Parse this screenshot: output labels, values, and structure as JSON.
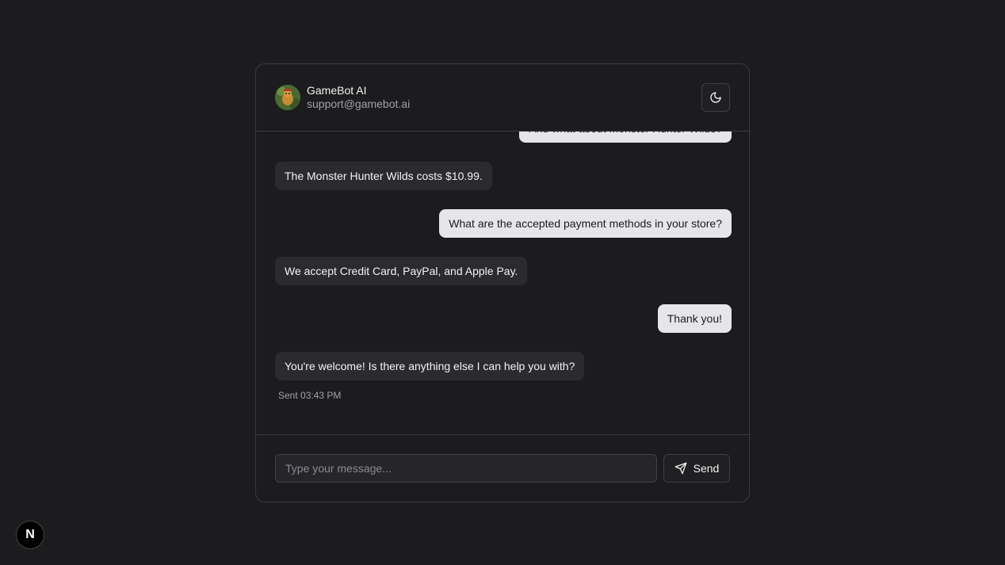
{
  "header": {
    "name": "GameBot AI",
    "email": "support@gamebot.ai"
  },
  "icons": {
    "theme": "moon-icon",
    "send": "send-icon",
    "avatar": "gamebot-avatar",
    "badge": "nextjs-logo-icon"
  },
  "messages": [
    {
      "role": "user",
      "text": "And what about Monster Hunter Wilds?"
    },
    {
      "role": "bot",
      "text": "The Monster Hunter Wilds costs $10.99."
    },
    {
      "role": "user",
      "text": "What are the accepted payment methods in your store?"
    },
    {
      "role": "bot",
      "text": "We accept Credit Card, PayPal, and Apple Pay."
    },
    {
      "role": "user",
      "text": "Thank you!"
    },
    {
      "role": "bot",
      "text": "You're welcome! Is there anything else I can help you with?"
    }
  ],
  "sent_label": "Sent 03:43 PM",
  "composer": {
    "placeholder": "Type your message...",
    "value": "",
    "send_label": "Send"
  },
  "badge_letter": "N",
  "colors": {
    "background": "#1c1c1e",
    "bot_bubble": "#2b2b2f",
    "user_bubble": "#e6e6e8",
    "border": "#3a3a3e"
  }
}
